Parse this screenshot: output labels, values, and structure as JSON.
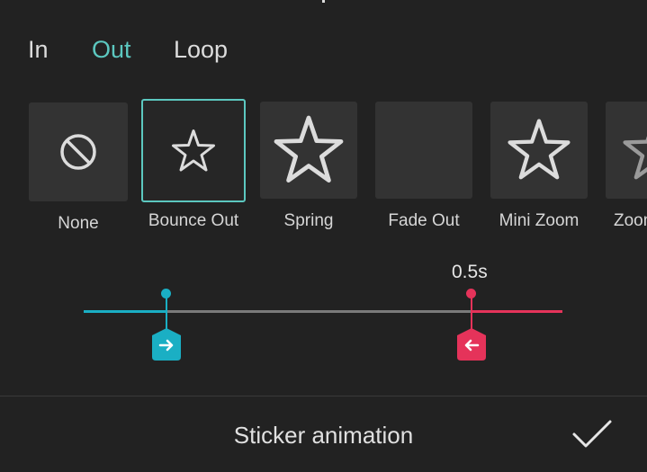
{
  "tabs": [
    {
      "label": "In",
      "active": false
    },
    {
      "label": "Out",
      "active": true
    },
    {
      "label": "Loop",
      "active": false
    }
  ],
  "presets": [
    {
      "label": "None",
      "icon": "no-entry-icon",
      "selected": false
    },
    {
      "label": "Bounce Out",
      "icon": "star-icon",
      "selected": true
    },
    {
      "label": "Spring",
      "icon": "star-icon",
      "selected": false
    },
    {
      "label": "Fade Out",
      "icon": "",
      "selected": false
    },
    {
      "label": "Mini Zoom",
      "icon": "star-icon",
      "selected": false
    },
    {
      "label": "Zoom",
      "icon": "star-icon",
      "selected": false
    }
  ],
  "timeline": {
    "duration_label": "0.5s",
    "in_handle_icon": "arrow-right-icon",
    "out_handle_icon": "arrow-left-icon"
  },
  "bottom_bar": {
    "title": "Sticker animation",
    "confirm_icon": "checkmark-icon"
  },
  "colors": {
    "background": "#222222",
    "accent_teal": "#5cc8c0",
    "in_color": "#1aafc4",
    "out_color": "#e5335a",
    "thumb_bg": "#333333",
    "track_grey": "#7a7a7a"
  }
}
